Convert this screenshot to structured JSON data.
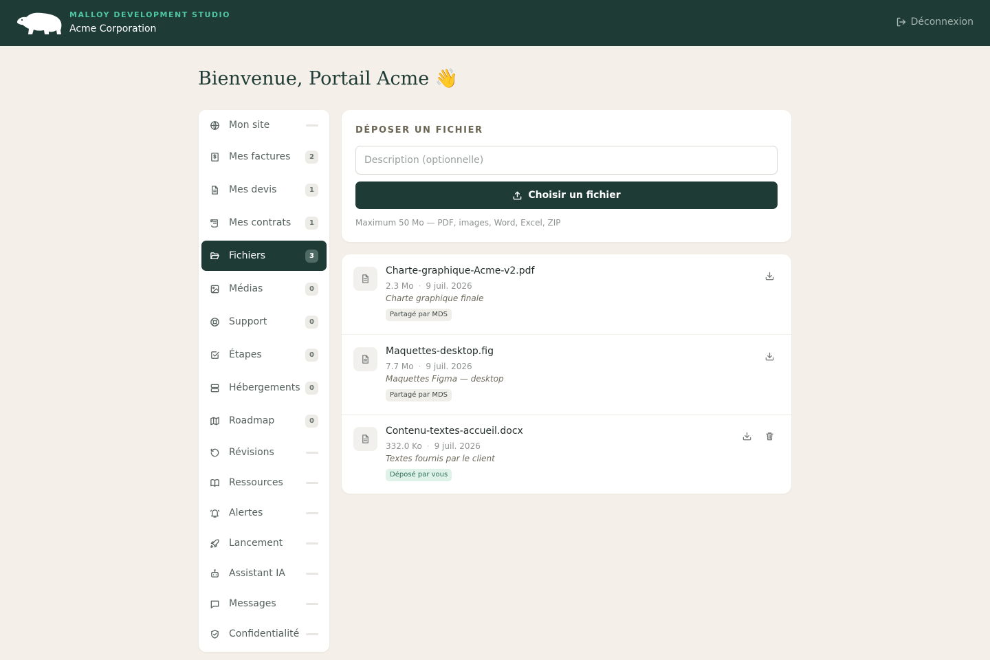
{
  "header": {
    "studio": "MALLOY DEVELOPMENT STUDIO",
    "company": "Acme Corporation",
    "logout_label": "Déconnexion",
    "logo_icon": "bear-logo-icon"
  },
  "page": {
    "title": "Bienvenue, Portail Acme 👋"
  },
  "sidebar": {
    "items": [
      {
        "label": "Mon site",
        "icon": "globe-icon",
        "badge": "",
        "active": false
      },
      {
        "label": "Mes factures",
        "icon": "invoice-icon",
        "badge": "2",
        "active": false
      },
      {
        "label": "Mes devis",
        "icon": "document-icon",
        "badge": "1",
        "active": false
      },
      {
        "label": "Mes contrats",
        "icon": "contract-icon",
        "badge": "1",
        "active": false
      },
      {
        "label": "Fichiers",
        "icon": "folder-icon",
        "badge": "3",
        "active": true
      },
      {
        "label": "Médias",
        "icon": "image-icon",
        "badge": "0",
        "active": false
      },
      {
        "label": "Support",
        "icon": "lifebuoy-icon",
        "badge": "0",
        "active": false
      },
      {
        "label": "Étapes",
        "icon": "checkbox-icon",
        "badge": "0",
        "active": false
      },
      {
        "label": "Hébergements",
        "icon": "server-icon",
        "badge": "0",
        "active": false
      },
      {
        "label": "Roadmap",
        "icon": "map-icon",
        "badge": "0",
        "active": false
      },
      {
        "label": "Révisions",
        "icon": "history-icon",
        "badge": "",
        "active": false
      },
      {
        "label": "Ressources",
        "icon": "book-icon",
        "badge": "",
        "active": false
      },
      {
        "label": "Alertes",
        "icon": "bell-icon",
        "badge": "",
        "active": false
      },
      {
        "label": "Lancement",
        "icon": "rocket-icon",
        "badge": "",
        "active": false
      },
      {
        "label": "Assistant IA",
        "icon": "bot-icon",
        "badge": "",
        "active": false
      },
      {
        "label": "Messages",
        "icon": "message-icon",
        "badge": "",
        "active": false
      },
      {
        "label": "Confidentialité",
        "icon": "shield-icon",
        "badge": "",
        "active": false
      }
    ]
  },
  "upload": {
    "heading": "DÉPOSER UN FICHIER",
    "description_placeholder": "Description (optionnelle)",
    "description_value": "",
    "button_label": "Choisir un fichier",
    "hint": "Maximum 50 Mo — PDF, images, Word, Excel, ZIP"
  },
  "files": [
    {
      "name": "Charte-graphique-Acme-v2.pdf",
      "size": "2.3 Mo",
      "date": "9 juil. 2026",
      "description": "Charte graphique finale",
      "tag": "Partagé par MDS",
      "tag_type": "mds",
      "deletable": false
    },
    {
      "name": "Maquettes-desktop.fig",
      "size": "7.7 Mo",
      "date": "9 juil. 2026",
      "description": "Maquettes Figma — desktop",
      "tag": "Partagé par MDS",
      "tag_type": "mds",
      "deletable": false
    },
    {
      "name": "Contenu-textes-accueil.docx",
      "size": "332.0 Ko",
      "date": "9 juil. 2026",
      "description": "Textes fournis par le client",
      "tag": "Déposé par vous",
      "tag_type": "client",
      "deletable": true
    }
  ],
  "colors": {
    "brand_dark": "#1e3b35",
    "accent_green": "#4fc7a3",
    "background": "#f4f0e9"
  }
}
